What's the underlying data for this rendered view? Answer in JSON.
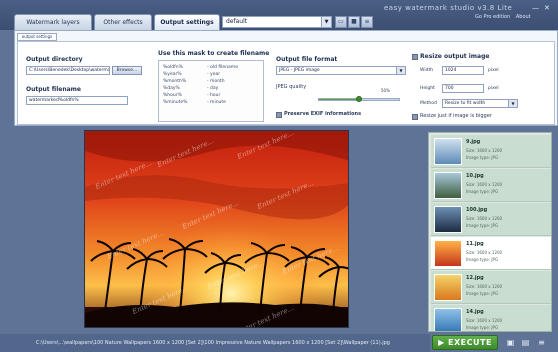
{
  "app": {
    "title": "easy watermark studio",
    "version": "v3.8 Lite",
    "links": [
      "Go Pro edition",
      "About"
    ]
  },
  "tabs": [
    {
      "label": "Watermark layers",
      "active": false
    },
    {
      "label": "Other effects",
      "active": false
    },
    {
      "label": "Output settings",
      "active": true
    }
  ],
  "preset": {
    "value": "default"
  },
  "panel": {
    "subtab": "output settings",
    "output_directory": {
      "label": "Output directory",
      "value": "C:\\Users\\Benedek\\Desktop\\watermarked",
      "browse": "Browse..."
    },
    "output_filename": {
      "label": "Output filename",
      "value": "watermarked%oldfn%"
    },
    "mask": {
      "label": "Use this mask to create filename",
      "rows": [
        {
          "k": "%oldfn%",
          "v": "- old filename"
        },
        {
          "k": "%year%",
          "v": "- year"
        },
        {
          "k": "%month%",
          "v": "- month"
        },
        {
          "k": "%day%",
          "v": "- day"
        },
        {
          "k": "%hour%",
          "v": "- hour"
        },
        {
          "k": "%minute%",
          "v": "- minute"
        }
      ]
    },
    "file_format": {
      "label": "Output file format",
      "value": "JPEG - JPEG image",
      "quality_label": "JPEG quality",
      "quality_value": "50%",
      "quality_fraction": 0.5,
      "exif_label": "Preserve EXIF informations"
    },
    "resize": {
      "label": "Resize output image",
      "width_label": "Width",
      "width_value": "1024",
      "width_unit": "pixel",
      "height_label": "Height",
      "height_value": "700",
      "height_unit": "pixel",
      "method_label": "Method",
      "method_value": "Resize to fit width",
      "bigger_label": "Resize just if image is bigger"
    }
  },
  "preview": {
    "watermark_text": "Enter text here..."
  },
  "status": {
    "path": "C:\\Users\\...\\wallpapers\\100 Nature Wallpapers 1600 x 1200 [Set 2]\\100 Impressive Nature Wallpapers 1600 x 1200 [Set 2]\\Wallpaper (11).jpg"
  },
  "thumbnails": [
    {
      "name": "9.jpg",
      "size": "Size: 1600 x 1200",
      "type": "Image type: JPG",
      "selected": false,
      "colors": [
        "#5e8ab6",
        "#cfe0ef"
      ]
    },
    {
      "name": "10.jpg",
      "size": "Size: 1600 x 1200",
      "type": "Image type: JPG",
      "selected": false,
      "colors": [
        "#3f5f3e",
        "#a8c6da"
      ]
    },
    {
      "name": "100.jpg",
      "size": "Size: 1600 x 1200",
      "type": "Image type: JPG",
      "selected": false,
      "colors": [
        "#1c2c44",
        "#6d90b4"
      ]
    },
    {
      "name": "11.jpg",
      "size": "Size: 1600 x 1200",
      "type": "Image type: JPG",
      "selected": true,
      "colors": [
        "#c5361a",
        "#ffb347"
      ]
    },
    {
      "name": "12.jpg",
      "size": "Size: 1600 x 1200",
      "type": "Image type: JPG",
      "selected": false,
      "colors": [
        "#d9781e",
        "#f4d36a"
      ]
    },
    {
      "name": "14.jpg",
      "size": "Size: 1600 x 1200",
      "type": "Image type: JPG",
      "selected": false,
      "colors": [
        "#2e6fb0",
        "#8fc2e8"
      ]
    }
  ],
  "actions": {
    "execute": "EXECUTE"
  }
}
